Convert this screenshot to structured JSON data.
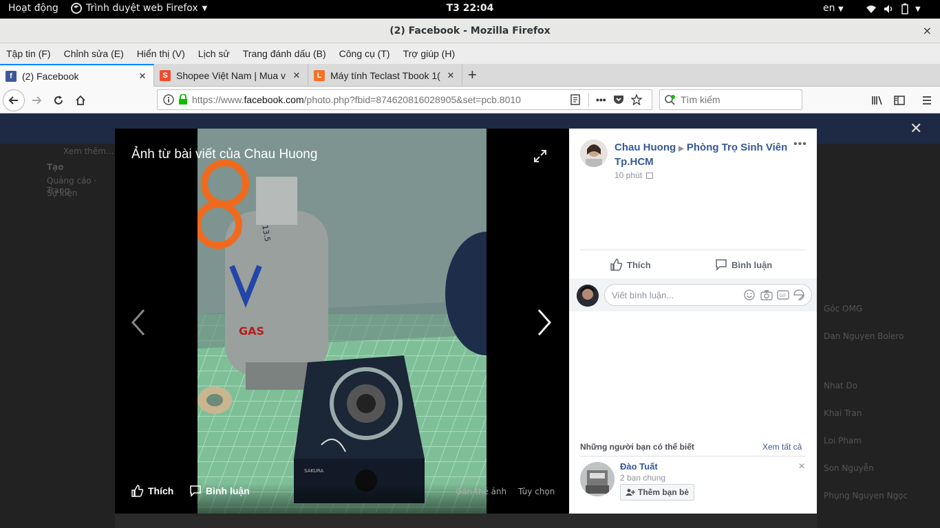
{
  "topbar": {
    "activities": "Hoạt động",
    "app_name": "Trình duyệt web Firefox",
    "clock": "T3 22:04",
    "language": "en"
  },
  "window": {
    "title": "(2) Facebook - Mozilla Firefox",
    "close": "×"
  },
  "menu": [
    "Tập tin (F)",
    "Chỉnh sửa (E)",
    "Hiển thị (V)",
    "Lịch sử",
    "Trang đánh dấu (B)",
    "Công cụ (T)",
    "Trợ giúp (H)"
  ],
  "tabs": [
    {
      "label": "(2) Facebook",
      "favicon": "facebook-icon",
      "color": "#3b5998",
      "active": true
    },
    {
      "label": "Shopee Việt Nam | Mua v",
      "favicon": "shopee-icon",
      "color": "#ee4d2d",
      "active": false
    },
    {
      "label": "Máy tính Teclast Tbook 1(",
      "favicon": "lazada-icon",
      "color": "#f57224",
      "active": false
    }
  ],
  "navbar": {
    "url_prefix": "https://www.",
    "url_domain": "facebook.com",
    "url_rest": "/photo.php?fbid=874620816028905&set=pcb.8010",
    "search_placeholder": "Tìm kiếm"
  },
  "viewer": {
    "title": "Ảnh từ bài viết của Chau Huong",
    "like": "Thích",
    "comment": "Bình luận",
    "tag_photo": "Gắn thẻ ảnh",
    "options": "Tùy chọn",
    "photo_labels": {
      "gas": "GAS",
      "weight": "13.5",
      "brand": "SAKURA"
    }
  },
  "panel": {
    "author": "Chau Huong",
    "group": "Phòng Trọ Sinh Viên Tp.HCM",
    "time": "10 phút",
    "like": "Thích",
    "comment": "Bình luận",
    "comment_placeholder": "Viết bình luận...",
    "pymk_title": "Những người bạn có thể biết",
    "see_all": "Xem tất cả",
    "friend": {
      "name": "Đào Tuất",
      "mutual": "2 bạn chung",
      "add": "Thêm bạn bè"
    }
  },
  "background": {
    "left": [
      "Xem thêm...",
      "Tạo",
      "Quảng cáo · Trang",
      "Sự kiện"
    ],
    "right": [
      "Góc OMG",
      "Dan Nguyen Bolero",
      "Nhat Do",
      "Khai Tran",
      "Loi Pham",
      "Son Nguyễn",
      "Phụng Nguyen Ngọc"
    ]
  },
  "colors": {
    "fb_blue": "#365899",
    "firefox_accent": "#0a84ff"
  }
}
